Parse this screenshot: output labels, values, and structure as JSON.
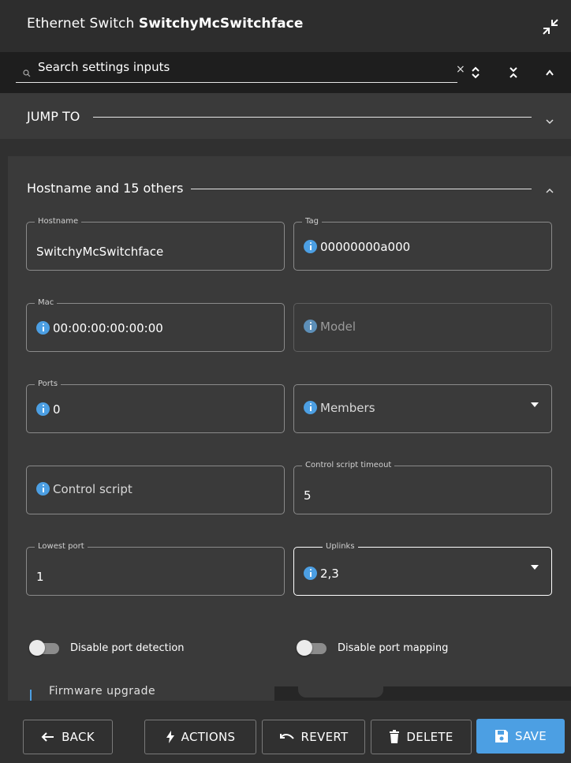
{
  "window": {
    "title_prefix": "Ethernet Switch",
    "title_name": "SwitchyMcSwitchface"
  },
  "search": {
    "placeholder": "Search settings inputs",
    "clear_label": "×"
  },
  "jump_to": {
    "label": "JUMP TO"
  },
  "section": {
    "label": "Hostname and 15 others"
  },
  "fields": {
    "hostname": {
      "label": "Hostname",
      "value": "SwitchyMcSwitchface"
    },
    "tag": {
      "label": "Tag",
      "value": "00000000a000"
    },
    "mac": {
      "label": "Mac",
      "value": "00:00:00:00:00:00"
    },
    "model": {
      "label": "",
      "value": "Model"
    },
    "ports": {
      "label": "Ports",
      "value": "0"
    },
    "members": {
      "label": "",
      "value": "Members"
    },
    "control_script": {
      "label": "",
      "value": "Control script"
    },
    "control_script_timeout": {
      "label": "Control script timeout",
      "value": "5"
    },
    "lowest_port": {
      "label": "Lowest port",
      "value": "1"
    },
    "uplinks": {
      "label": "Uplinks",
      "value": "2,3"
    }
  },
  "toggles": {
    "disable_port_detection": {
      "label": "Disable port detection",
      "on": false
    },
    "disable_port_mapping": {
      "label": "Disable port mapping",
      "on": false
    }
  },
  "peek": {
    "label": "Firmware upgrade"
  },
  "footer": {
    "back": "BACK",
    "actions": "ACTIONS",
    "revert": "REVERT",
    "delete": "DELETE",
    "save": "SAVE"
  },
  "colors": {
    "accent": "#4c9fe3",
    "background": "#303030",
    "panel": "#3a3a3a",
    "search_bg": "#1e1e1e"
  }
}
